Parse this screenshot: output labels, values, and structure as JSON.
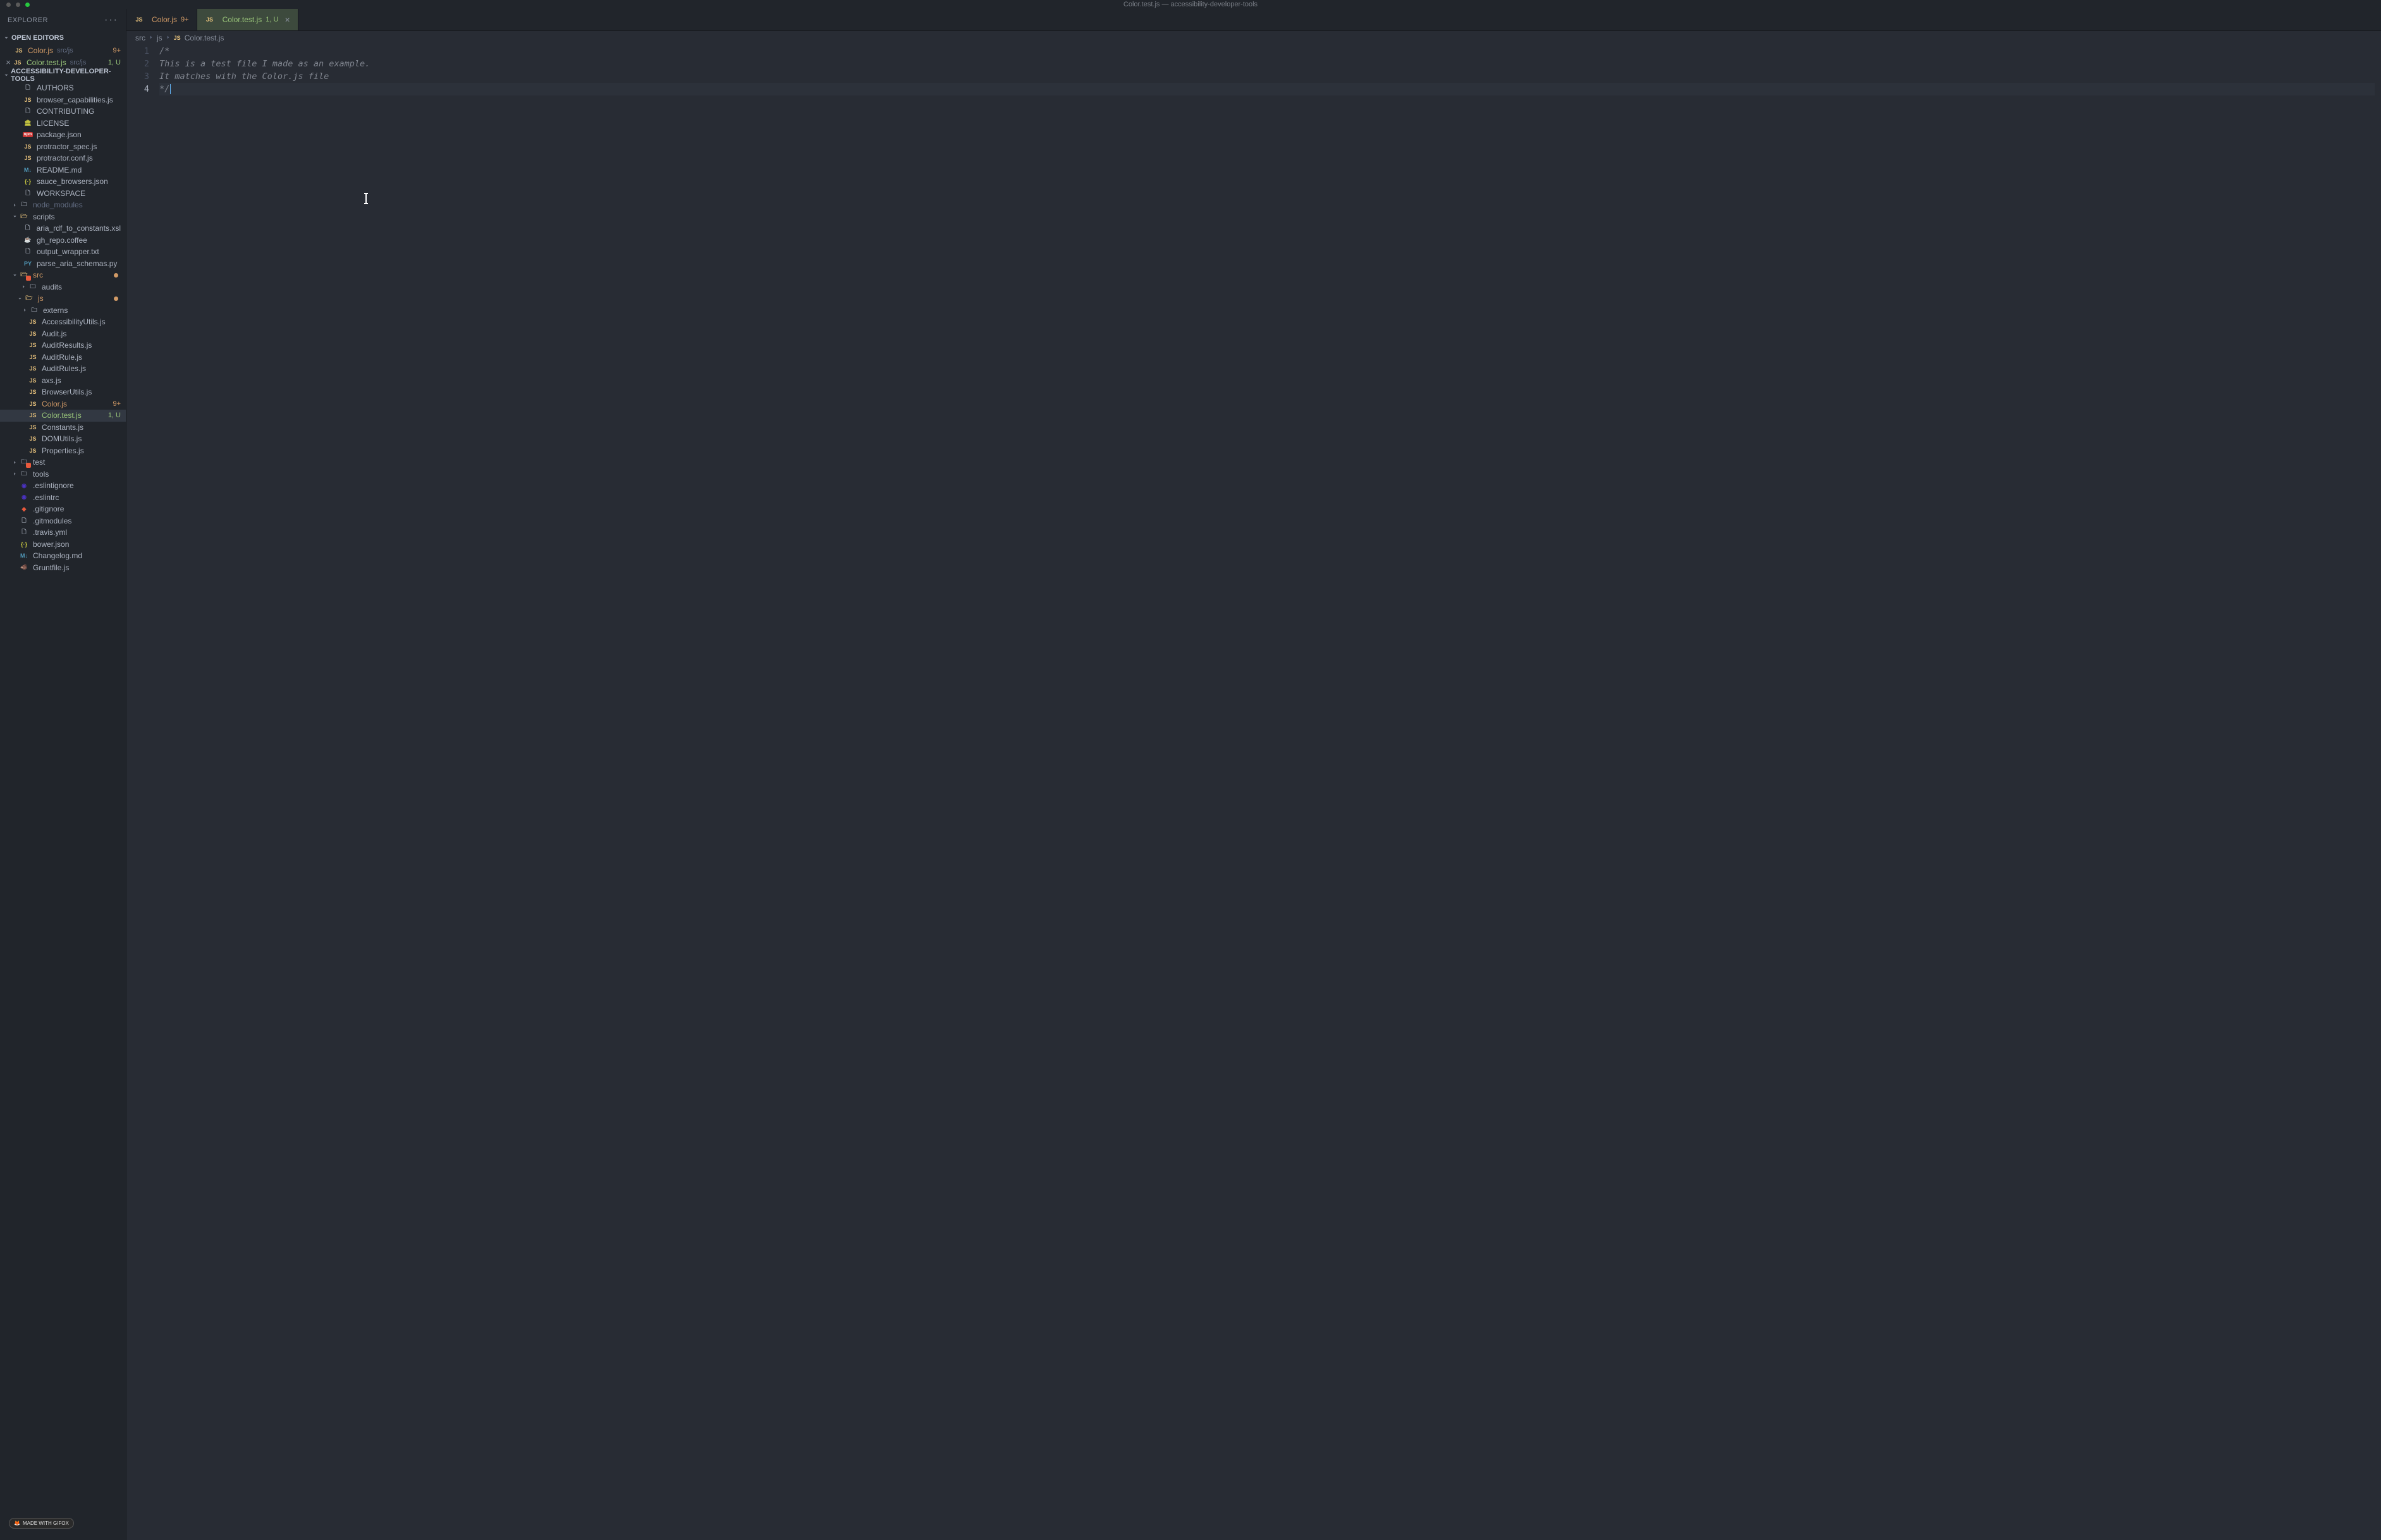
{
  "titlebar": {
    "title": "Color.test.js — accessibility-developer-tools"
  },
  "explorer": {
    "title": "EXPLORER",
    "sections": {
      "open_editors": "OPEN EDITORS",
      "project": "ACCESSIBILITY-DEVELOPER-TOOLS"
    }
  },
  "open_editors": [
    {
      "name": "Color.js",
      "path": "src/js",
      "badge": "9+",
      "badge_type": "m"
    },
    {
      "name": "Color.test.js",
      "path": "src/js",
      "badge": "1, U",
      "badge_type": "u",
      "active": true
    }
  ],
  "tree": {
    "root_files": [
      {
        "name": "AUTHORS",
        "icon": "file"
      },
      {
        "name": "browser_capabilities.js",
        "icon": "js"
      },
      {
        "name": "CONTRIBUTING",
        "icon": "file"
      },
      {
        "name": "LICENSE",
        "icon": "license"
      },
      {
        "name": "package.json",
        "icon": "npm"
      },
      {
        "name": "protractor_spec.js",
        "icon": "js"
      },
      {
        "name": "protractor.conf.js",
        "icon": "js"
      },
      {
        "name": "README.md",
        "icon": "md"
      },
      {
        "name": "sauce_browsers.json",
        "icon": "json"
      },
      {
        "name": "WORKSPACE",
        "icon": "file"
      }
    ],
    "node_modules": "node_modules",
    "scripts": {
      "label": "scripts",
      "files": [
        {
          "name": "aria_rdf_to_constants.xsl",
          "icon": "file"
        },
        {
          "name": "gh_repo.coffee",
          "icon": "coffee"
        },
        {
          "name": "output_wrapper.txt",
          "icon": "file"
        },
        {
          "name": "parse_aria_schemas.py",
          "icon": "py"
        }
      ]
    },
    "src": {
      "label": "src",
      "audits": "audits",
      "js": {
        "label": "js",
        "externs": "externs",
        "files": [
          {
            "name": "AccessibilityUtils.js"
          },
          {
            "name": "Audit.js"
          },
          {
            "name": "AuditResults.js"
          },
          {
            "name": "AuditRule.js"
          },
          {
            "name": "AuditRules.js"
          },
          {
            "name": "axs.js"
          },
          {
            "name": "BrowserUtils.js"
          },
          {
            "name": "Color.js",
            "mod": true,
            "badge": "9+"
          },
          {
            "name": "Color.test.js",
            "untracked": true,
            "badge": "1, U",
            "selected": true
          },
          {
            "name": "Constants.js"
          },
          {
            "name": "DOMUtils.js"
          },
          {
            "name": "Properties.js"
          }
        ]
      }
    },
    "test": "test",
    "tools": "tools",
    "bottom_files": [
      {
        "name": ".eslintignore",
        "icon": "eslint"
      },
      {
        "name": ".eslintrc",
        "icon": "eslint"
      },
      {
        "name": ".gitignore",
        "icon": "git"
      },
      {
        "name": ".gitmodules",
        "icon": "file"
      },
      {
        "name": ".travis.yml",
        "icon": "file"
      },
      {
        "name": "bower.json",
        "icon": "json"
      },
      {
        "name": "Changelog.md",
        "icon": "md",
        "obscured": true
      },
      {
        "name": "Gruntfile.js",
        "icon": "js-grunt"
      }
    ]
  },
  "tabs": [
    {
      "name": "Color.js",
      "suffix": "9+",
      "mod": true
    },
    {
      "name": "Color.test.js",
      "suffix": "1, U",
      "untracked": true,
      "active": true,
      "close": true
    }
  ],
  "breadcrumbs": [
    {
      "label": "src"
    },
    {
      "label": "js"
    },
    {
      "label": "Color.test.js",
      "icon": "js"
    }
  ],
  "editor": {
    "lines": [
      {
        "n": 1,
        "text": "/*"
      },
      {
        "n": 2,
        "text": "This is a test file I made as an example."
      },
      {
        "n": 3,
        "text": "It matches with the Color.js file"
      },
      {
        "n": 4,
        "text": "*/",
        "active": true,
        "cursor": true
      }
    ]
  },
  "gifox": "MADE WITH GIFOX"
}
